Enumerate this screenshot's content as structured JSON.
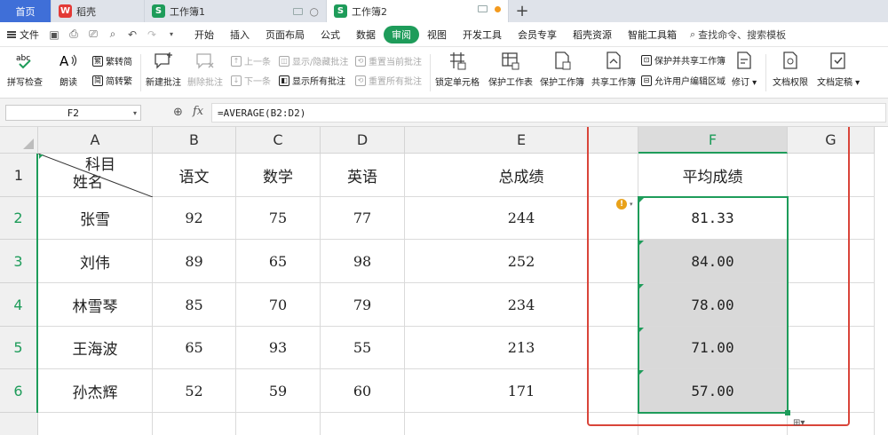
{
  "tabs": {
    "home": "首页",
    "doc": "稻壳",
    "sheet1": "工作簿1",
    "sheet2": "工作簿2"
  },
  "menu": {
    "file": "文件",
    "items": [
      "开始",
      "插入",
      "页面布局",
      "公式",
      "数据",
      "审阅",
      "视图",
      "开发工具",
      "会员专享",
      "稻壳资源",
      "智能工具箱"
    ],
    "active_index": 5,
    "search": "查找命令、搜索模板"
  },
  "ribbon": {
    "spell_check": "拼写检查",
    "read_aloud": "朗读",
    "trad_to_simp": "繁转简",
    "simp_to_trad": "简转繁",
    "new_comment": "新建批注",
    "delete_comment": "删除批注",
    "prev_comment": "上一条",
    "next_comment": "下一条",
    "show_hide_comment": "显示/隐藏批注",
    "show_all_comments": "显示所有批注",
    "reset_current_comment": "重置当前批注",
    "reset_all_comments": "重置所有批注",
    "lock_cell": "锁定单元格",
    "protect_sheet": "保护工作表",
    "protect_workbook": "保护工作簿",
    "share_workbook": "共享工作簿",
    "protect_and_share": "保护并共享工作簿",
    "allow_edit_ranges": "允许用户编辑区域",
    "track_changes": "修订",
    "doc_permission": "文档权限",
    "doc_finalize": "文档定稿"
  },
  "formula_bar": {
    "name_box": "F2",
    "fx": "fx",
    "formula": "=AVERAGE(B2:D2)"
  },
  "sheet": {
    "columns": [
      "A",
      "B",
      "C",
      "D",
      "E",
      "F",
      "G"
    ],
    "rows": [
      "1",
      "2",
      "3",
      "4",
      "5",
      "6"
    ],
    "header_row": {
      "a1_top": "科目",
      "a1_bottom": "姓名",
      "b": "语文",
      "c": "数学",
      "d": "英语",
      "e": "总成绩",
      "f": "平均成绩"
    },
    "data": [
      {
        "name": "张雪",
        "chinese": "92",
        "math": "75",
        "english": "77",
        "total": "244",
        "avg": "81.33"
      },
      {
        "name": "刘伟",
        "chinese": "89",
        "math": "65",
        "english": "98",
        "total": "252",
        "avg": "84.00"
      },
      {
        "name": "林雪琴",
        "chinese": "85",
        "math": "70",
        "english": "79",
        "total": "234",
        "avg": "78.00"
      },
      {
        "name": "王海波",
        "chinese": "65",
        "math": "93",
        "english": "55",
        "total": "213",
        "avg": "71.00"
      },
      {
        "name": "孙杰辉",
        "chinese": "52",
        "math": "59",
        "english": "60",
        "total": "171",
        "avg": "57.00"
      }
    ]
  },
  "colors": {
    "accent_green": "#1e9c5a",
    "highlight_red": "#d9453a",
    "home_tab_blue": "#3f6fd8"
  }
}
